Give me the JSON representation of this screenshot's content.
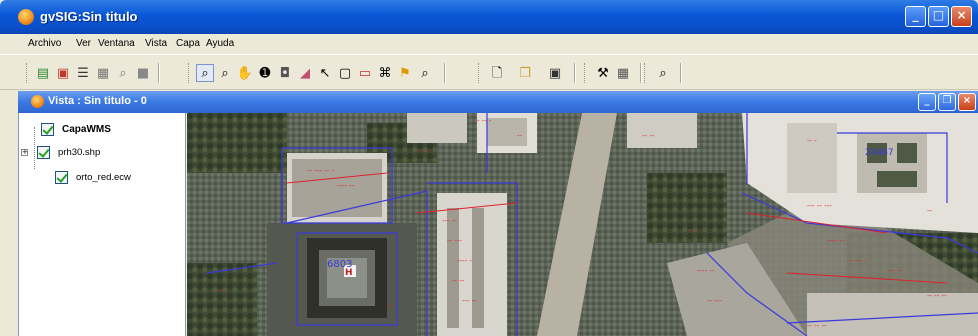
{
  "window": {
    "title": "gvSIG:Sin titulo",
    "controls": [
      "minimize-icon",
      "maximize-icon",
      "close-icon"
    ]
  },
  "menu": {
    "items": [
      "Archivo",
      "Ver",
      "Ventana",
      "Vista",
      "Capa",
      "Ayuda"
    ]
  },
  "toolbar": {
    "buttons": [
      "add-layer-icon",
      "remove-layer-icon",
      "layer-manager-icon",
      "layer-properties-icon",
      "zoom-layer-icon",
      "overview-icon",
      "zoom-in-icon",
      "zoom-out-icon",
      "pan-icon",
      "info-icon",
      "measure-icon",
      "area-icon",
      "select-icon",
      "select-rect-icon",
      "select-polygon-icon",
      "full-extent-icon",
      "locator-icon",
      "zoom-previous-icon",
      "new-project-icon",
      "open-project-icon",
      "save-project-icon",
      "tools-icon",
      "table-icon",
      "zoom-scale-icon"
    ]
  },
  "view": {
    "title": "Vista : Sin titulo - 0",
    "controls": [
      "minimize-icon",
      "restore-icon",
      "close-icon"
    ],
    "layers": [
      {
        "name": "CapaWMS",
        "checked": true,
        "bold": true
      },
      {
        "name": "prh30.shp",
        "checked": true,
        "bold": false
      },
      {
        "name": "orto_red.ecw",
        "checked": true,
        "bold": false
      }
    ],
    "map": {
      "labels": [
        "6803",
        "24467"
      ],
      "colors": {
        "parcel_outline": "#3a3adb",
        "annotation": "#e0202a"
      }
    }
  }
}
